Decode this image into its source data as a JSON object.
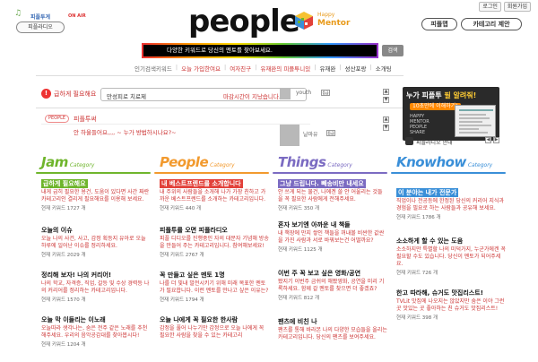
{
  "top_links": [
    "로그인",
    "회원가입"
  ],
  "radio": {
    "title": "피플투게",
    "on_air": "ON AIR",
    "button": "피플라디오"
  },
  "logo": {
    "word": "people",
    "happy": "Happy",
    "mentor": "Mentor"
  },
  "header_buttons": [
    "피플맵",
    "카테고리 제안"
  ],
  "search": {
    "placeholder": "다양한 키워드로 당신의 멘토를 찾아보세요.",
    "button": "검색"
  },
  "keywords": {
    "label": "인기검색키워드",
    "items": [
      "오늘 가입한여요",
      "여자친구",
      "유재완의 피플투니있",
      "유재완",
      "성산포랑",
      "소개팅"
    ]
  },
  "ticker": {
    "label": "급하게 필요해요",
    "question": "만성피로 치료제",
    "status": "마감시간이 지났습니다.",
    "user": "youth",
    "badge": "등급"
  },
  "mail": {
    "tag": "PEOPLE",
    "title": "피플투써",
    "message": "안 하울들어요,,,, ~ 누가 방법하시나요?~",
    "user": "날마유",
    "badge": "등급"
  },
  "ad": {
    "headline_a": "누가 피플투 ",
    "headline_b": "필 알려줘!",
    "sub": "10초만에 이해하기!",
    "small": [
      "HAPPY",
      "MENTOR",
      "PEOPLE",
      "SHARE"
    ],
    "footer": "피플라디오 안내"
  },
  "categories": [
    {
      "name": "Jam",
      "suffix": "Category",
      "color": "#6fb52c",
      "items": [
        {
          "title": "급하게 필요해요",
          "highlight": true,
          "desc": "내게 급히 필요한 용건, 도움이 있다면 사간 짜란 카테고리인 결리게 필요해요를 이용해 보세요.",
          "count": "현재 키워드 1727 개"
        },
        {
          "title": "오늘의 이슈",
          "highlight": false,
          "desc": "오늘 나의 사건, 사고, 감정 획등지 유아로 오늘 하루에 일어난 이슈를 정리하세요.",
          "count": "현재 키워드 2029 개"
        },
        {
          "title": "정리해 보자! 나의 커리어!",
          "highlight": false,
          "desc": "나의 학교, 자격증, 직업, 갈등 및 수상 경력등 나의 커리어를 정리하는 카테고리입니다.",
          "count": "현재 키워드 1570 개"
        },
        {
          "title": "오늘 막 이들리는 이노래",
          "highlight": false,
          "desc": "오늘따라 생각나는, 숨은 전주 같은 노래를 추천해주세요. 우리의 음악공감대를 찾아봅시다!",
          "count": "현재 키워드 1204 개"
        }
      ]
    },
    {
      "name": "People",
      "suffix": "Category",
      "color": "#f29a2e",
      "items": [
        {
          "title": "내 베스트프렌드를 소개합니다",
          "highlight": true,
          "desc": "내 주위의 사람들을 소개해 나가 가장 친하고 가까운 베스트프렌드를 소개하는 카테고리입니다.",
          "count": "현재 키워드 440 개"
        },
        {
          "title": "피플투를 오면 피플라디오",
          "highlight": false,
          "desc": "피플 디디오를 진행중인 자의 대문자 기념해 방송을 만들어 주는 카테고리입니다. 참여해보세요!",
          "count": "현재 키워드 2767 개"
        },
        {
          "title": "꼭 만들고 싶은 멘토 1명",
          "highlight": false,
          "desc": "나를 더 빛내 발전시키기 위해 미래 목표한 멘토가 필요합니다. 이런 멘토를 만나고 싶은 이유는?",
          "count": "현재 키워드 1794 개"
        },
        {
          "title": "오늘 나에게 꼭 필요한 한사람",
          "highlight": false,
          "desc": "감정을 풀어 나누기만 감정으로 오늘 나에게 꼭 필요한 사람을 찾을 수 있는 카테고리",
          "count": ""
        }
      ]
    },
    {
      "name": "Things",
      "suffix": "Category",
      "color": "#7b6bc2",
      "items": [
        {
          "title": "그냥 드립니다. 빼송비만 내세요",
          "highlight": true,
          "desc": "안 쓰게 되는 물건, 나에겐 쓸 안 어울리는 것들을 꼭 필요한 사람에게 전해주세요.",
          "count": "현재 키워드 350 개"
        },
        {
          "title": "혼자 보기엔 아까운 내 책들",
          "highlight": false,
          "desc": "내 책장에 만지 쌓인 책들을 꺼내볼 비싼한 값싼을 가진 사람과 서로 바꿔보는건 어떨까요?",
          "count": "현재 키워드 1125 개"
        },
        {
          "title": "이번 주 꼭 보고 싶은 영화/공연",
          "highlight": false,
          "desc": "봤지기 이번주 금쉬의 해봤영화, 공연을 미리 기록하세요. 함께 갈 멘토를 찾으면 더 좋겠죠?",
          "count": "현재 키워드 812 개"
        },
        {
          "title": "팬츠에 비친 나",
          "highlight": false,
          "desc": "팬츠를 통해 바라본 나의 다양한 모습들을 올리는 카테고리입니다. 당신의 팬츠를 보여주세요.",
          "count": ""
        }
      ]
    },
    {
      "name": "Knowhow",
      "suffix": "Category",
      "color": "#3a8fd8",
      "items": [
        {
          "title": "이 분야는 내가 전문가",
          "highlight": true,
          "desc": "직업이나 전공등에 한정된 당신의 커리어 지식과 경험을 필요로 하는 사람들과 공유해 보세요.",
          "count": "현재 키워드 1786 개"
        },
        {
          "title": "소소하게 할 수 있는 도움",
          "highlight": false,
          "desc": "소소하지만 특별할 나의 미덕가지, 누군가에겐 꼭 필요할 수도 있습니다. 당신이 멘토가 되어주세요.",
          "count": "현재 키워드 726 개"
        },
        {
          "title": "한고 따라해, 슈거도 맛집리스트!",
          "highlight": false,
          "desc": "TVLit 맛집에 나오지는 않았지만 숨은 이야 그런 곳 맛있는 곳 좋아하는 친 슈거도 맛집리스트!",
          "count": "현재 키워드 398 개"
        },
        {
          "title": "",
          "highlight": false,
          "desc": "",
          "count": ""
        }
      ]
    }
  ]
}
